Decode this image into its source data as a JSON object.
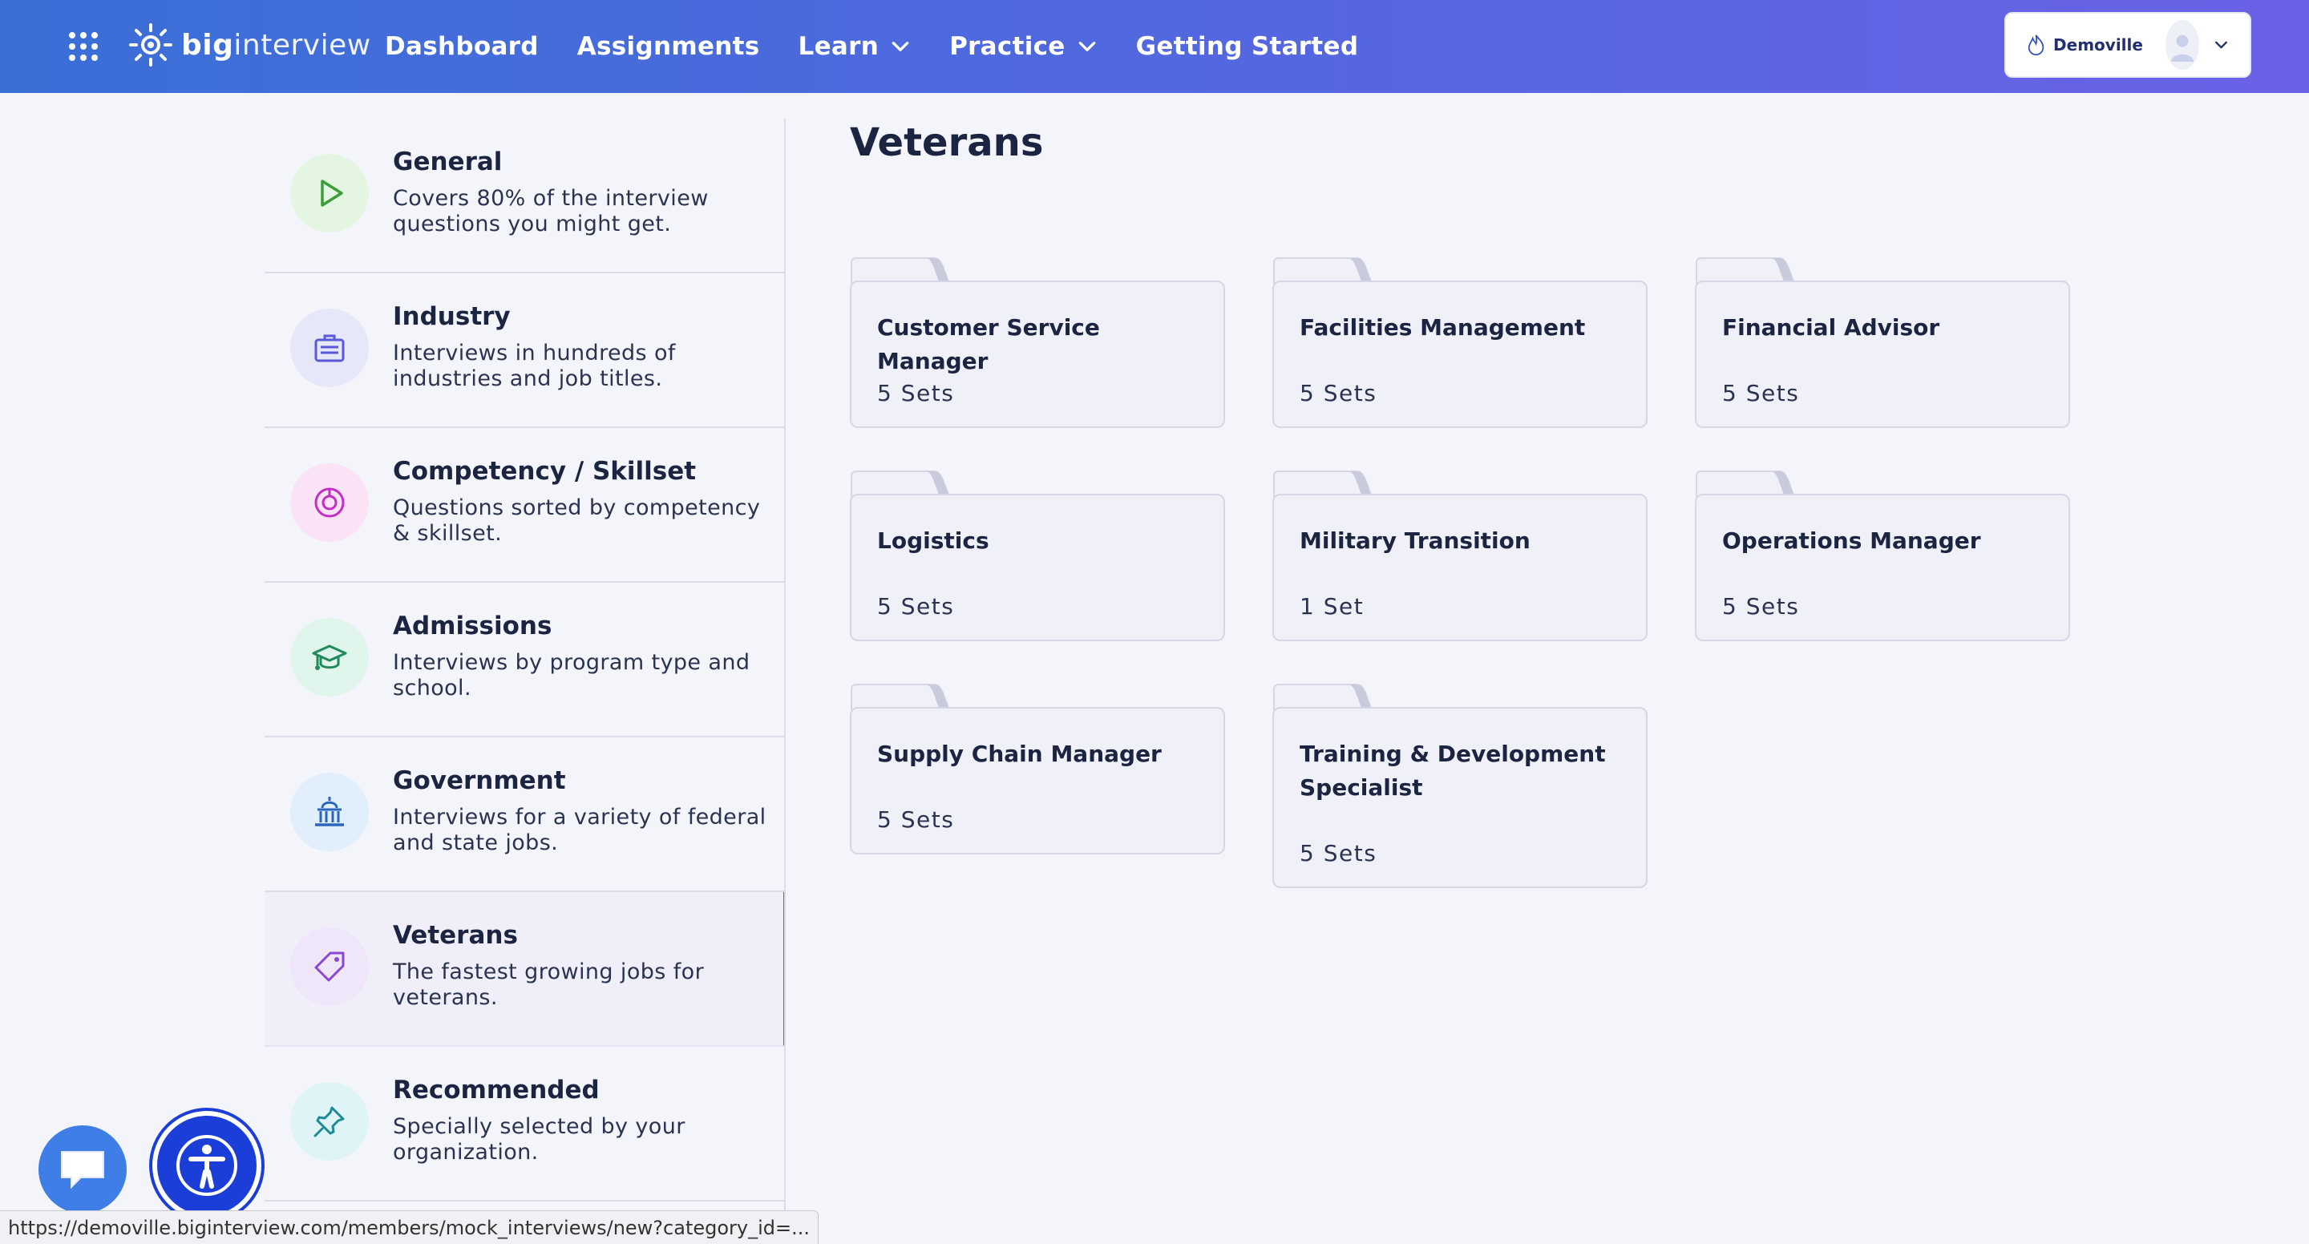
{
  "header": {
    "logo_bold": "big",
    "logo_light": "interview",
    "nav": [
      {
        "label": "Dashboard"
      },
      {
        "label": "Assignments"
      },
      {
        "label": "Learn",
        "has_menu": true
      },
      {
        "label": "Practice",
        "has_menu": true
      },
      {
        "label": "Getting Started"
      }
    ],
    "account": {
      "org": "Demoville",
      "logo_icon": "flame-logo-icon",
      "avatar_icon": "user-avatar-icon"
    }
  },
  "sidebar": {
    "categories": [
      {
        "title": "General",
        "desc": "Covers 80% of the interview questions you might get.",
        "icon": "play-icon",
        "color": "#3c9e3a",
        "bg": "#e4f6e1"
      },
      {
        "title": "Industry",
        "desc": "Interviews in hundreds of industries and job titles.",
        "icon": "briefcase-icon",
        "color": "#5a5ad8",
        "bg": "#e7e7fa"
      },
      {
        "title": "Competency / Skillset",
        "desc": "Questions sorted by competency & skillset.",
        "icon": "target-icon",
        "color": "#c32fc4",
        "bg": "#fbe3f7"
      },
      {
        "title": "Admissions",
        "desc": "Interviews by program type and school.",
        "icon": "graduation-cap-icon",
        "color": "#1f8a5a",
        "bg": "#e0f5ec"
      },
      {
        "title": "Government",
        "desc": "Interviews for a variety of federal and state jobs.",
        "icon": "capitol-building-icon",
        "color": "#2a66c0",
        "bg": "#e1eefb"
      },
      {
        "title": "Veterans",
        "desc": "The fastest growing jobs for veterans.",
        "icon": "tag-icon",
        "color": "#8a48d0",
        "bg": "#efe6fa",
        "active": true
      },
      {
        "title": "Recommended",
        "desc": "Specially selected by your organization.",
        "icon": "pushpin-icon",
        "color": "#1d8a9a",
        "bg": "#dff4f6"
      }
    ]
  },
  "main": {
    "title": "Veterans",
    "folders": [
      {
        "name": "Customer Service Manager",
        "count": "5 Sets"
      },
      {
        "name": "Facilities Management",
        "count": "5 Sets"
      },
      {
        "name": "Financial Advisor",
        "count": "5 Sets"
      },
      {
        "name": "Logistics",
        "count": "5 Sets"
      },
      {
        "name": "Military Transition",
        "count": "1 Set"
      },
      {
        "name": "Operations Manager",
        "count": "5 Sets"
      },
      {
        "name": "Supply Chain Manager",
        "count": "5 Sets"
      },
      {
        "name": "Training & Development Specialist",
        "count": "5 Sets"
      }
    ]
  },
  "widgets": {
    "chat_icon": "chat-bubble-icon",
    "accessibility_icon": "accessibility-icon"
  },
  "status_url": "https://demoville.biginterview.com/members/mock_interviews/new?category_id=..."
}
